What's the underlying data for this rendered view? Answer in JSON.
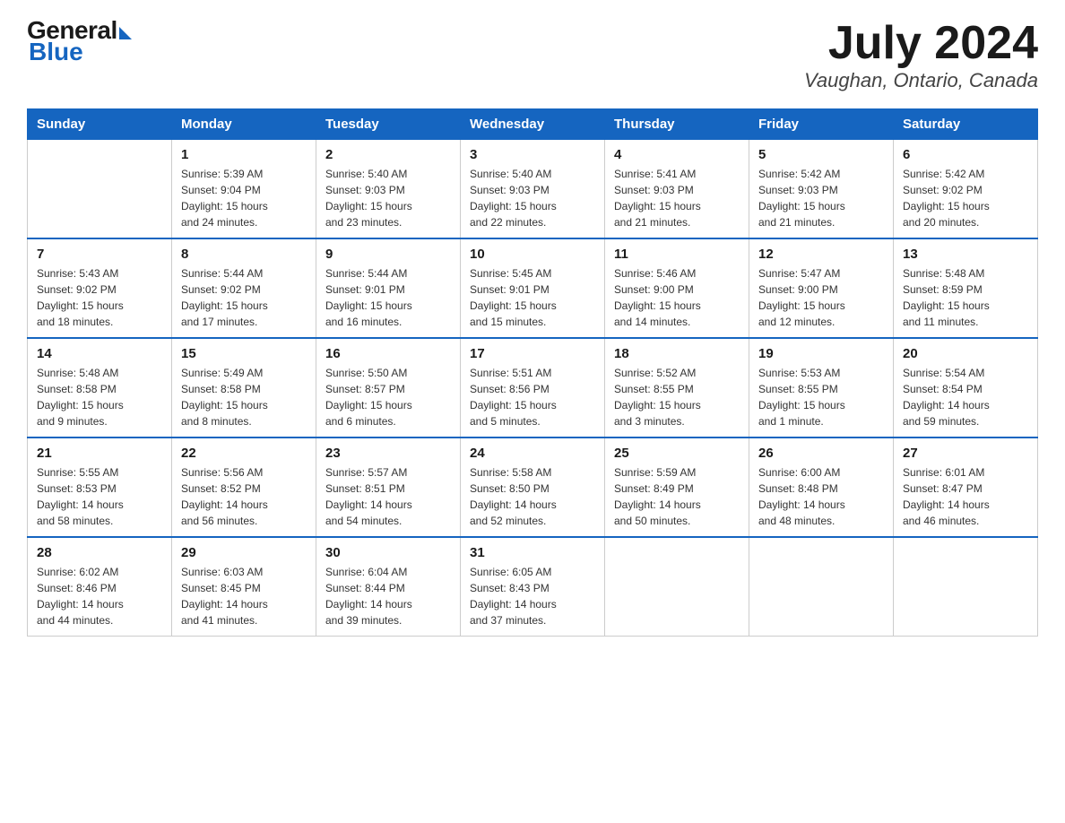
{
  "header": {
    "logo": {
      "general": "General",
      "blue": "Blue"
    },
    "title": "July 2024",
    "location": "Vaughan, Ontario, Canada"
  },
  "days_of_week": [
    "Sunday",
    "Monday",
    "Tuesday",
    "Wednesday",
    "Thursday",
    "Friday",
    "Saturday"
  ],
  "weeks": [
    [
      {
        "day": "",
        "info": ""
      },
      {
        "day": "1",
        "info": "Sunrise: 5:39 AM\nSunset: 9:04 PM\nDaylight: 15 hours\nand 24 minutes."
      },
      {
        "day": "2",
        "info": "Sunrise: 5:40 AM\nSunset: 9:03 PM\nDaylight: 15 hours\nand 23 minutes."
      },
      {
        "day": "3",
        "info": "Sunrise: 5:40 AM\nSunset: 9:03 PM\nDaylight: 15 hours\nand 22 minutes."
      },
      {
        "day": "4",
        "info": "Sunrise: 5:41 AM\nSunset: 9:03 PM\nDaylight: 15 hours\nand 21 minutes."
      },
      {
        "day": "5",
        "info": "Sunrise: 5:42 AM\nSunset: 9:03 PM\nDaylight: 15 hours\nand 21 minutes."
      },
      {
        "day": "6",
        "info": "Sunrise: 5:42 AM\nSunset: 9:02 PM\nDaylight: 15 hours\nand 20 minutes."
      }
    ],
    [
      {
        "day": "7",
        "info": "Sunrise: 5:43 AM\nSunset: 9:02 PM\nDaylight: 15 hours\nand 18 minutes."
      },
      {
        "day": "8",
        "info": "Sunrise: 5:44 AM\nSunset: 9:02 PM\nDaylight: 15 hours\nand 17 minutes."
      },
      {
        "day": "9",
        "info": "Sunrise: 5:44 AM\nSunset: 9:01 PM\nDaylight: 15 hours\nand 16 minutes."
      },
      {
        "day": "10",
        "info": "Sunrise: 5:45 AM\nSunset: 9:01 PM\nDaylight: 15 hours\nand 15 minutes."
      },
      {
        "day": "11",
        "info": "Sunrise: 5:46 AM\nSunset: 9:00 PM\nDaylight: 15 hours\nand 14 minutes."
      },
      {
        "day": "12",
        "info": "Sunrise: 5:47 AM\nSunset: 9:00 PM\nDaylight: 15 hours\nand 12 minutes."
      },
      {
        "day": "13",
        "info": "Sunrise: 5:48 AM\nSunset: 8:59 PM\nDaylight: 15 hours\nand 11 minutes."
      }
    ],
    [
      {
        "day": "14",
        "info": "Sunrise: 5:48 AM\nSunset: 8:58 PM\nDaylight: 15 hours\nand 9 minutes."
      },
      {
        "day": "15",
        "info": "Sunrise: 5:49 AM\nSunset: 8:58 PM\nDaylight: 15 hours\nand 8 minutes."
      },
      {
        "day": "16",
        "info": "Sunrise: 5:50 AM\nSunset: 8:57 PM\nDaylight: 15 hours\nand 6 minutes."
      },
      {
        "day": "17",
        "info": "Sunrise: 5:51 AM\nSunset: 8:56 PM\nDaylight: 15 hours\nand 5 minutes."
      },
      {
        "day": "18",
        "info": "Sunrise: 5:52 AM\nSunset: 8:55 PM\nDaylight: 15 hours\nand 3 minutes."
      },
      {
        "day": "19",
        "info": "Sunrise: 5:53 AM\nSunset: 8:55 PM\nDaylight: 15 hours\nand 1 minute."
      },
      {
        "day": "20",
        "info": "Sunrise: 5:54 AM\nSunset: 8:54 PM\nDaylight: 14 hours\nand 59 minutes."
      }
    ],
    [
      {
        "day": "21",
        "info": "Sunrise: 5:55 AM\nSunset: 8:53 PM\nDaylight: 14 hours\nand 58 minutes."
      },
      {
        "day": "22",
        "info": "Sunrise: 5:56 AM\nSunset: 8:52 PM\nDaylight: 14 hours\nand 56 minutes."
      },
      {
        "day": "23",
        "info": "Sunrise: 5:57 AM\nSunset: 8:51 PM\nDaylight: 14 hours\nand 54 minutes."
      },
      {
        "day": "24",
        "info": "Sunrise: 5:58 AM\nSunset: 8:50 PM\nDaylight: 14 hours\nand 52 minutes."
      },
      {
        "day": "25",
        "info": "Sunrise: 5:59 AM\nSunset: 8:49 PM\nDaylight: 14 hours\nand 50 minutes."
      },
      {
        "day": "26",
        "info": "Sunrise: 6:00 AM\nSunset: 8:48 PM\nDaylight: 14 hours\nand 48 minutes."
      },
      {
        "day": "27",
        "info": "Sunrise: 6:01 AM\nSunset: 8:47 PM\nDaylight: 14 hours\nand 46 minutes."
      }
    ],
    [
      {
        "day": "28",
        "info": "Sunrise: 6:02 AM\nSunset: 8:46 PM\nDaylight: 14 hours\nand 44 minutes."
      },
      {
        "day": "29",
        "info": "Sunrise: 6:03 AM\nSunset: 8:45 PM\nDaylight: 14 hours\nand 41 minutes."
      },
      {
        "day": "30",
        "info": "Sunrise: 6:04 AM\nSunset: 8:44 PM\nDaylight: 14 hours\nand 39 minutes."
      },
      {
        "day": "31",
        "info": "Sunrise: 6:05 AM\nSunset: 8:43 PM\nDaylight: 14 hours\nand 37 minutes."
      },
      {
        "day": "",
        "info": ""
      },
      {
        "day": "",
        "info": ""
      },
      {
        "day": "",
        "info": ""
      }
    ]
  ]
}
